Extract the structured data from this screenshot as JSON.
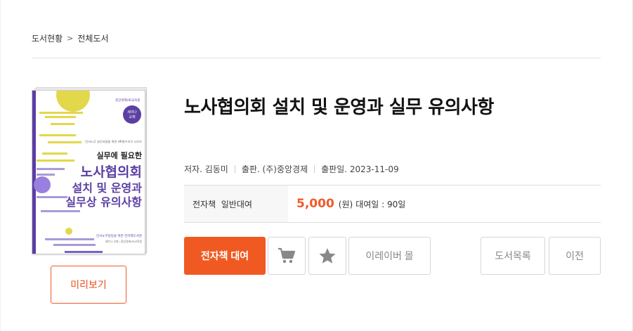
{
  "breadcrumb": {
    "items": [
      "도서현황",
      "전체도서"
    ],
    "separator": ">"
  },
  "book": {
    "title": "노사협의회 설치 및 운영과 실무 유의사항",
    "author": "저자. 김동미",
    "publisher": "출판. (주)중앙경제",
    "pub_date": "출판일. 2023-11-09",
    "cover": {
      "publisher_logo": "중앙경제HR교육원",
      "badge": "세미나 교재",
      "small_caption": "인사노무 실무자들을 위한 HR필수지식 시리즈",
      "line1": "실무에 필요한",
      "line2": "노사협의회",
      "line3": "설치 및 운영과",
      "line4": "실무상 유의사항",
      "bottom_caption": "인사노무담당을 위한 전자책도서관",
      "bottom_subcaption": "세미나 교재 / 중앙경제HR교육원"
    }
  },
  "price": {
    "label": "전자책  일반대여",
    "amount": "5,000",
    "unit": "(원)",
    "period": "대여일 : 90일"
  },
  "buttons": {
    "preview": "미리보기",
    "rent": "전자책 대여",
    "cart_icon": "cart-icon",
    "wish_icon": "star-icon",
    "mall": "이레이버 몰",
    "book_list": "도서목록",
    "prev": "이전"
  },
  "colors": {
    "accent": "#f05a22",
    "cover_purple": "#5b3fa3",
    "cover_yellow": "#e2d84a"
  }
}
